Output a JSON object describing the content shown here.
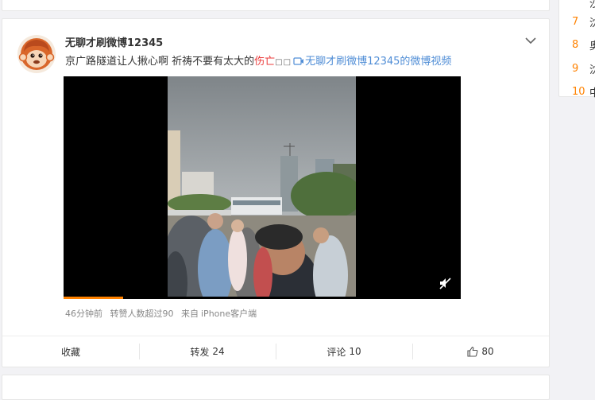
{
  "post": {
    "username": "无聊才刷微博12345",
    "text_pre": "京广路隧道让人揪心啊 祈祷不要有太大的",
    "text_highlight": "伤亡",
    "text_boxes": "□□",
    "video_link": "无聊才刷微博12345的微博视频",
    "meta": {
      "time": "46分钟前",
      "reposts_info": "转赞人数超过90",
      "source_prefix": "来自",
      "source": "iPhone客户端"
    },
    "video": {
      "progress": 0.15
    }
  },
  "actions": {
    "favorite": "收藏",
    "repost": "转发",
    "repost_count": "24",
    "comment": "评论",
    "comment_count": "10",
    "like_count": "80"
  },
  "sidebar": {
    "items": [
      {
        "rank": "",
        "text": "沙"
      },
      {
        "rank": "7",
        "text": "沈"
      },
      {
        "rank": "8",
        "text": "奥"
      },
      {
        "rank": "9",
        "text": "沈"
      },
      {
        "rank": "10",
        "text": "中"
      }
    ]
  },
  "colors": {
    "accent": "#ff8200",
    "link": "#4f8dd6",
    "highlight": "#eb3b3b"
  }
}
